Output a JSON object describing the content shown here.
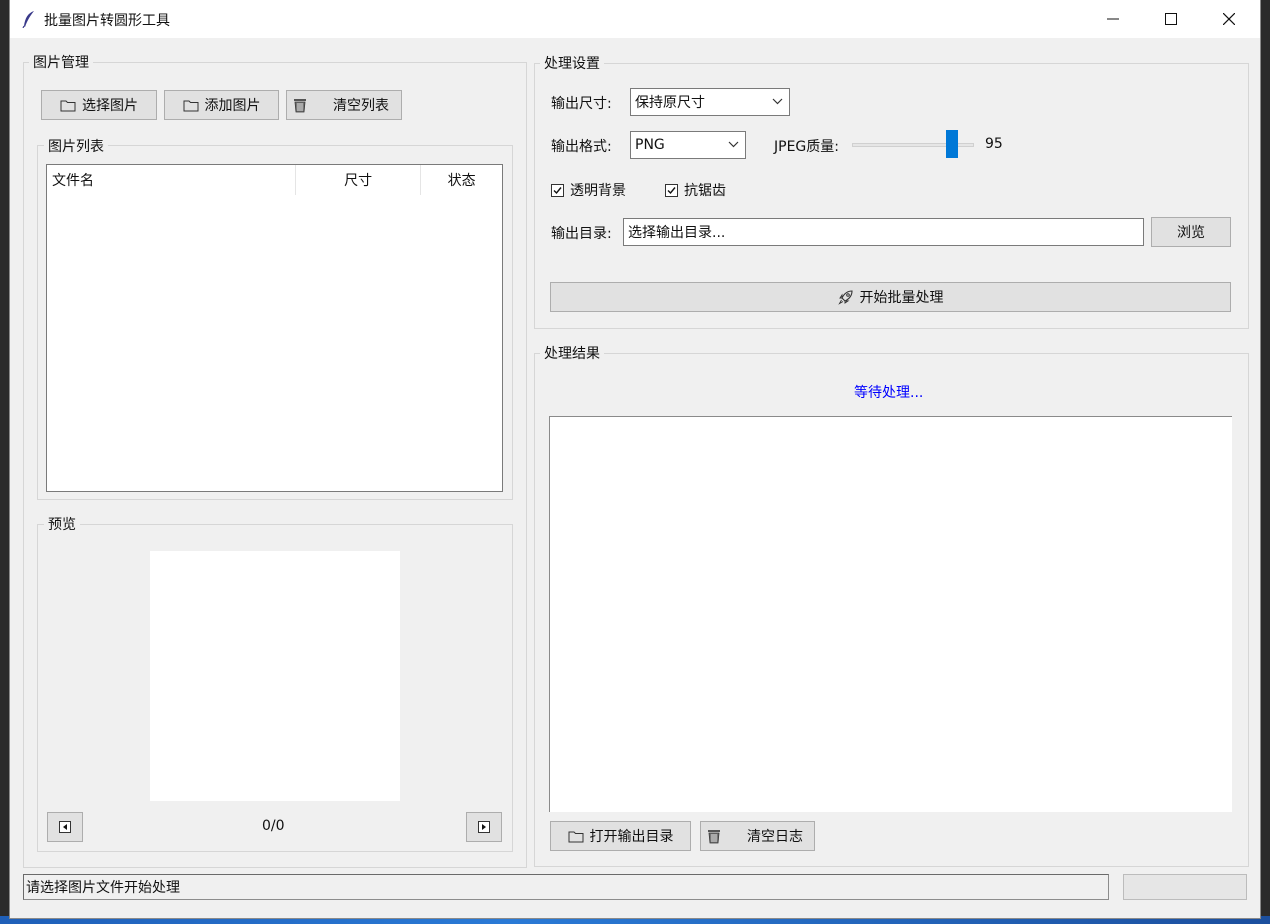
{
  "window": {
    "title": "批量图片转圆形工具",
    "icon": "feather-icon"
  },
  "left": {
    "group_title": "图片管理",
    "buttons": {
      "select": "选择图片",
      "add": "添加图片",
      "clear": "清空列表"
    },
    "list": {
      "group_title": "图片列表",
      "columns": [
        "文件名",
        "尺寸",
        "状态"
      ],
      "rows": []
    },
    "preview": {
      "group_title": "预览",
      "counter": "0/0"
    }
  },
  "settings": {
    "group_title": "处理设置",
    "size_label": "输出尺寸:",
    "size_value": "保持原尺寸",
    "format_label": "输出格式:",
    "format_value": "PNG",
    "quality_label": "JPEG质量:",
    "quality_value": "95",
    "quality_fraction": 0.85,
    "transparent_label": "透明背景",
    "transparent_checked": true,
    "antialias_label": "抗锯齿",
    "antialias_checked": true,
    "outdir_label": "输出目录:",
    "outdir_value": "选择输出目录...",
    "browse_label": "浏览",
    "start_label": "开始批量处理"
  },
  "results": {
    "group_title": "处理结果",
    "status": "等待处理...",
    "status_color": "#0000ff",
    "open_dir_label": "打开输出目录",
    "clear_log_label": "清空日志"
  },
  "statusbar": {
    "text": "请选择图片文件开始处理",
    "progress": 0
  },
  "colors": {
    "accent": "#0078d7",
    "window_bg": "#f0f0f0"
  }
}
